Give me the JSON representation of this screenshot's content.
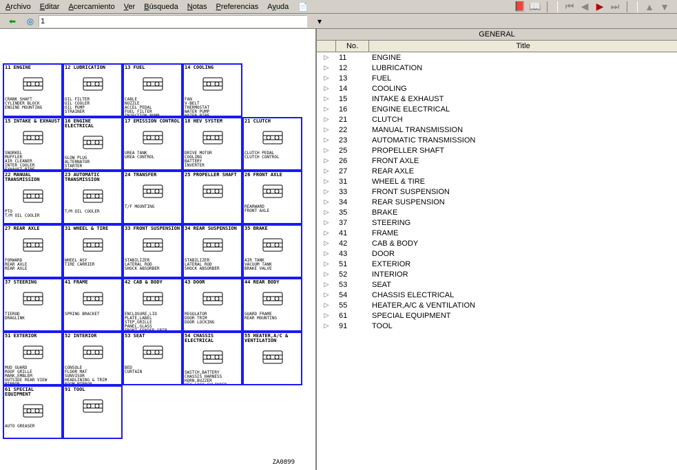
{
  "menubar": {
    "items": [
      "Archivo",
      "Editar",
      "Acercamiento",
      "Ver",
      "Búsqueda",
      "Notas",
      "Preferencias",
      "Ayuda"
    ]
  },
  "toolbar": {
    "nav_value": "1"
  },
  "right": {
    "title": "GENERAL",
    "columns": {
      "no": "No.",
      "title": "Title"
    },
    "rows": [
      {
        "no": "11",
        "title": "ENGINE"
      },
      {
        "no": "12",
        "title": "LUBRICATION"
      },
      {
        "no": "13",
        "title": "FUEL"
      },
      {
        "no": "14",
        "title": "COOLING"
      },
      {
        "no": "15",
        "title": "INTAKE & EXHAUST"
      },
      {
        "no": "16",
        "title": "ENGINE ELECTRICAL"
      },
      {
        "no": "21",
        "title": "CLUTCH"
      },
      {
        "no": "22",
        "title": "MANUAL TRANSMISSION"
      },
      {
        "no": "23",
        "title": "AUTOMATIC TRANSMISSION"
      },
      {
        "no": "25",
        "title": "PROPELLER SHAFT"
      },
      {
        "no": "26",
        "title": "FRONT AXLE"
      },
      {
        "no": "27",
        "title": "REAR AXLE"
      },
      {
        "no": "31",
        "title": "WHEEL & TIRE"
      },
      {
        "no": "33",
        "title": "FRONT SUSPENSION"
      },
      {
        "no": "34",
        "title": "REAR SUSPENSION"
      },
      {
        "no": "35",
        "title": "BRAKE"
      },
      {
        "no": "37",
        "title": "STEERING"
      },
      {
        "no": "41",
        "title": "FRAME"
      },
      {
        "no": "42",
        "title": "CAB & BODY"
      },
      {
        "no": "43",
        "title": "DOOR"
      },
      {
        "no": "51",
        "title": "EXTERIOR"
      },
      {
        "no": "52",
        "title": "INTERIOR"
      },
      {
        "no": "53",
        "title": "SEAT"
      },
      {
        "no": "54",
        "title": "CHASSIS ELECTRICAL"
      },
      {
        "no": "55",
        "title": "HEATER,A/C & VENTILATION"
      },
      {
        "no": "61",
        "title": "SPECIAL EQUIPMENT"
      },
      {
        "no": "91",
        "title": "TOOL"
      }
    ]
  },
  "diagram": {
    "footer_code": "ZA0899",
    "cells": [
      {
        "hdr": "11 ENGINE",
        "sub": "CRANK SHAFT\nCYLINDER BLOCK\nENGINE MOUNTING"
      },
      {
        "hdr": "12 LUBRICATION",
        "sub": "OIL FILTER\nOIL COOLER\nOIL PUMP\nSTRAINER"
      },
      {
        "hdr": "13 FUEL",
        "sub": "CABLE\nNOZZLE\nACCEL PEDAL\nFUEL FILTER\nINJECTION PUMP\nWATER SEPARATOR"
      },
      {
        "hdr": "14 COOLING",
        "sub": "FAN\nV-BELT\nTHERMOSTAT\nWATER PUMP\nWATER PIPE\nCONDENSER TANK"
      },
      {
        "hdr": "",
        "sub": ""
      },
      {
        "hdr": "15 INTAKE & EXHAUST",
        "sub": "SNORKEL\nMUFFLER\nAIR CLEANER\nINTER COOLER\nEXHAUST PIPE\nEXHAUST BRAKE"
      },
      {
        "hdr": "16 ENGINE ELECTRICAL",
        "sub": "GLOW PLUG\nALTERNATOR\nSTARTER\nRELAY\nENGINE HARNESS\nAIR INTAKE HEATER"
      },
      {
        "hdr": "17 EMISSION CONTROL",
        "sub": "UREA TANK\nUREA CONTROL"
      },
      {
        "hdr": "18 HEV SYSTEM",
        "sub": "DRIVE MOTOR\nCOOLING\nBATTERY\nINVERTER"
      },
      {
        "hdr": "21 CLUTCH",
        "sub": "CLUTCH PEDAL\nCLUTCH CONTROL"
      },
      {
        "hdr": "22 MANUAL TRANSMISSION",
        "sub": "PTO\nT/M OIL COOLER"
      },
      {
        "hdr": "23 AUTOMATIC TRANSMISSION",
        "sub": "T/M OIL COOLER"
      },
      {
        "hdr": "24 TRANSFER",
        "sub": "T/F MOUNTING"
      },
      {
        "hdr": "25 PROPELLER SHAFT",
        "sub": ""
      },
      {
        "hdr": "26 FRONT AXLE",
        "sub": "REARWARD\nFRONT AXLE"
      },
      {
        "hdr": "27 REAR AXLE",
        "sub": "FORWARD\nREAR AXLE\nREAR AXLE"
      },
      {
        "hdr": "31 WHEEL & TIRE",
        "sub": "WHEEL ASY\nTIRE CARRIER"
      },
      {
        "hdr": "33 FRONT SUSPENSION",
        "sub": "STABILIZER\nLATERAL ROD\nSHOCK ABSORBER"
      },
      {
        "hdr": "34 REAR SUSPENSION",
        "sub": "STABILIZER\nLATERAL ROD\nSHOCK ABSORBER"
      },
      {
        "hdr": "35 BRAKE",
        "sub": "AIR TANK\nVACUUM TANK\nBRAKE VALVE"
      },
      {
        "hdr": "37 STEERING",
        "sub": "TIEROD\nDRAGLINK"
      },
      {
        "hdr": "41 FRAME",
        "sub": "SPRING BRACKET"
      },
      {
        "hdr": "42 CAB & BODY",
        "sub": "ENCLOSURE,LID\nPLATE,LABEL\nSTEP,GRILLE\nPANEL,GLASS\nFRONT FENDER,GRIP\nCAB TILT,CAB MOUNTING"
      },
      {
        "hdr": "43 DOOR",
        "sub": "REGULATOR\nDOOR TRIM\nDOOR LOCKING"
      },
      {
        "hdr": "44 REAR BODY",
        "sub": "GUARD FRAME\nREAR MOUNTING"
      },
      {
        "hdr": "51 EXTERIOR",
        "sub": "MUD GUARD\nROOF GRILLE\nMARK,EMBLEM\nOUTSIDE REAR VIEW MIRROR"
      },
      {
        "hdr": "52 INTERIOR",
        "sub": "CONSOLE\nFLOOR MAT\nSUNVISOR\nHEADLINING & TRIM\nROOM MIRROR\nINSTRUMENT PANEL"
      },
      {
        "hdr": "53 SEAT",
        "sub": "BED\nCURTAIN"
      },
      {
        "hdr": "54 CHASSIS ELECTRICAL",
        "sub": "SWITCH,BATTERY\nCHASSIS HARNESS\nHORN,BUZZER\nKEY,LOCK CYLINDER\nLAMP,METER"
      },
      {
        "hdr": "55 HEATER,A/C & VENTILATION",
        "sub": ""
      },
      {
        "hdr": "61 SPECIAL EQUIPMENT",
        "sub": "AUTO GREASER"
      },
      {
        "hdr": "91 TOOL",
        "sub": ""
      }
    ]
  }
}
